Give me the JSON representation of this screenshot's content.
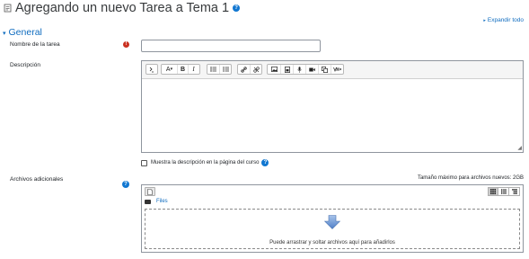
{
  "header": {
    "title": "Agregando un nuevo Tarea a Tema 1",
    "help_icon": "question-circle-icon"
  },
  "expand_all": "Expandir todo",
  "section": {
    "title": "General"
  },
  "fields": {
    "name": {
      "label": "Nombre de la tarea",
      "value": "",
      "required": true
    },
    "description": {
      "label": "Descripción",
      "toolbar": [
        "toggle-icon",
        "font-icon",
        "bold-icon",
        "italic-icon",
        "unordered-list-icon",
        "ordered-list-icon",
        "link-icon",
        "unlink-icon",
        "image-icon",
        "media-icon",
        "microphone-icon",
        "video-icon",
        "copy-icon",
        "special-icon"
      ],
      "bold": "B",
      "italic": "I",
      "font": "A",
      "value": ""
    },
    "show_description": {
      "label": "Muestra la descripción en la página del curso",
      "checked": false
    },
    "additional_files": {
      "label": "Archivos adicionales",
      "max_size": "Tamaño máximo para archivos nuevos: 2GB",
      "folder": "Files",
      "drop_hint": "Puede arrastrar y soltar archivos aquí para añadirlos"
    }
  },
  "colors": {
    "link": "#0f6cbf",
    "required": "#ca3120",
    "help": "#1177d1"
  }
}
